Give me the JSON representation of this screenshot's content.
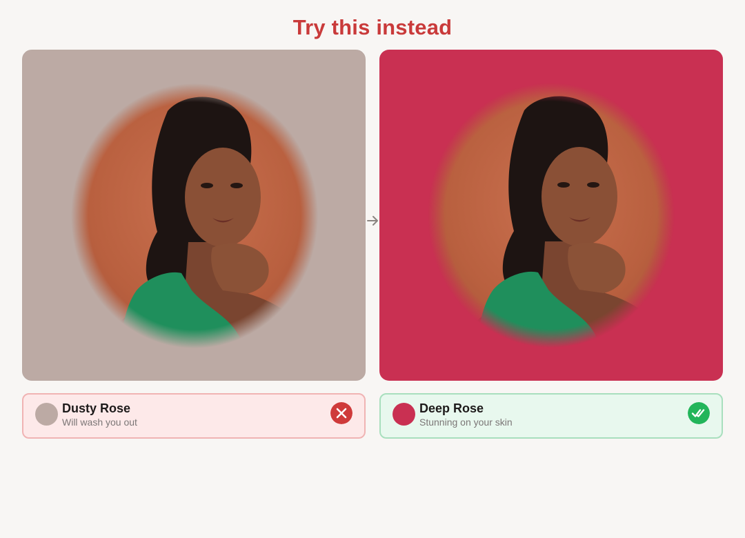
{
  "title": "Try this instead",
  "comparison": {
    "before": {
      "panel_color": "#bcaaa4",
      "swatch_color": "#bcaaa4",
      "name": "Dusty Rose",
      "subtitle": "Will wash you out",
      "status_icon": "x-circle-icon",
      "status_color": "#cf3a3a",
      "card_bg": "#fde9e9",
      "card_border": "#f0b3b3"
    },
    "after": {
      "panel_color": "#c93052",
      "swatch_color": "#c93052",
      "name": "Deep Rose",
      "subtitle": "Stunning on your skin",
      "status_icon": "double-check-circle-icon",
      "status_color": "#22b55a",
      "card_bg": "#e8f8ee",
      "card_border": "#a8dfbd"
    },
    "connector_icon": "arrow-right-icon"
  }
}
